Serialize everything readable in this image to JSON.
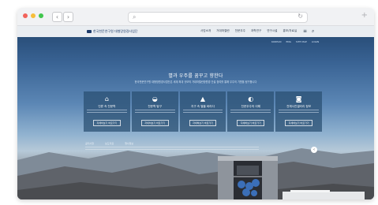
{
  "browser": {
    "back_icon": "chevron-left-icon",
    "forward_icon": "chevron-right-icon",
    "url_search_icon": "search-icon",
    "reload_icon": "reload-icon",
    "new_tab_icon": "plus-icon",
    "url": ""
  },
  "site": {
    "logo_text": "한국천문연구원 대형망원경사업단",
    "nav": [
      "사업소개",
      "거대마젤란",
      "천문우주",
      "과학연구",
      "연구시설",
      "홍보/자료실"
    ],
    "util": [
      "KOREAN",
      "ENG",
      "SITE MAP",
      "LOGIN"
    ]
  },
  "hero": {
    "title": "별과 우주를 꿈꾸고 향한다",
    "subtitle": "한국천문연구원 대형망원경사업단은 세계 최대 규모의 거대마젤란망원경 건설 참여를 통해 우주의 기원을 탐구합니다"
  },
  "cards": [
    {
      "icon": "building-icon",
      "title": "인류 속 천문학",
      "button": "자세히보기 바로가기"
    },
    {
      "icon": "telescope-icon",
      "title": "천문학 탐구",
      "button": "자세히보기 바로가기"
    },
    {
      "icon": "mountain-icon",
      "title": "지구 속 별을 바라다",
      "button": "자세히보기 바로가기"
    },
    {
      "icon": "moon-icon",
      "title": "천문우주의 이해",
      "button": "자세히보기 바로가기"
    },
    {
      "icon": "camera-icon",
      "title": "천체사진갤러리 정보",
      "button": "자세히보기 바로가기"
    }
  ],
  "notice": [
    "공지사항",
    "보도자료",
    "행사정보"
  ],
  "colors": {
    "accent": "#1d3b6a",
    "card_bg": "#284e70"
  }
}
